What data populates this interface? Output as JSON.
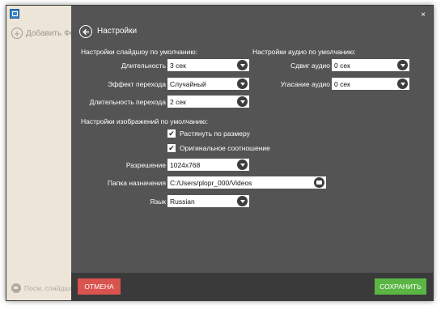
{
  "sidebar": {
    "add_photo_label": "Добавить Фото",
    "view_slideshow_label": "Посм. слайдшоу"
  },
  "header": {
    "close_label": "×",
    "title": "Настройки"
  },
  "slideshow": {
    "section_title": "Настройки слайдшоу по умолчанию:",
    "duration_label": "Длительность",
    "duration_value": "3 сек",
    "transition_label": "Эффект перехода",
    "transition_value": "Случайный",
    "transition_duration_label": "Длительность перехода",
    "transition_duration_value": "2 сек"
  },
  "audio": {
    "section_title": "Настройки аудио по умолчанию:",
    "shift_label": "Сдвиг аудио",
    "shift_value": "0 сек",
    "fade_label": "Угасание аудио",
    "fade_value": "0 сек"
  },
  "images": {
    "section_title": "Настройки изображений по умолчанию:",
    "stretch_label": "Растянуть по размеру",
    "stretch_checked": true,
    "aspect_label": "Оригинальное соотношение",
    "aspect_checked": true,
    "check_mark": "✔",
    "resolution_label": "Разрешение",
    "resolution_value": "1024x768",
    "folder_label": "Папка назначения",
    "folder_value": "C:/Users/plopr_000/Videos",
    "language_label": "Язык",
    "language_value": "Russian"
  },
  "footer": {
    "cancel_label": "ОТМЕНА",
    "save_label": "СОХРАНИТЬ"
  },
  "colors": {
    "main_bg": "#545454",
    "sidebar_bg": "#ede5d8",
    "footer_bg": "#3a3a3a",
    "cancel": "#d9534f",
    "save": "#5ab545"
  }
}
